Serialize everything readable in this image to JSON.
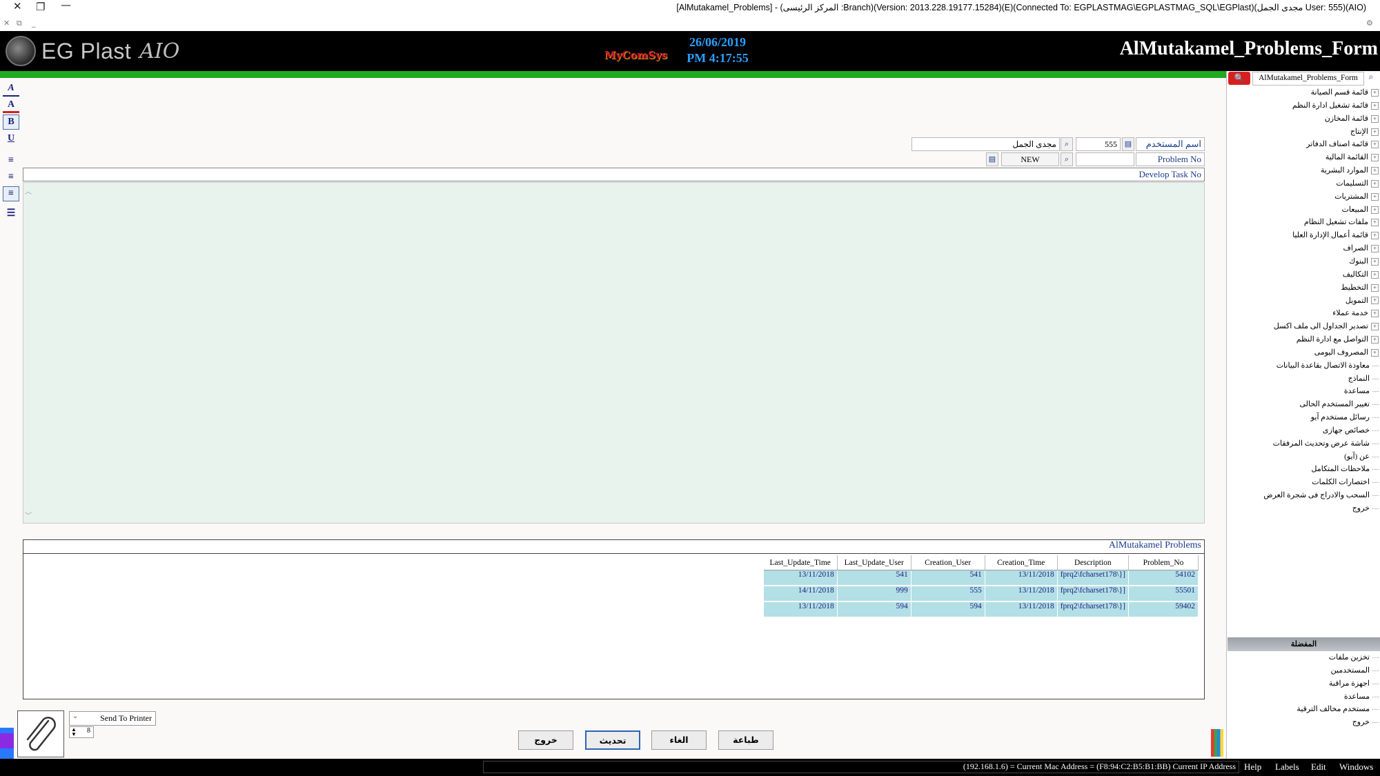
{
  "window": {
    "title": "[AlMutakamel_Problems] - (المركز الرئيسى :Branch)(Version: 2013.228.19177.15284)(E)(Connected To: EGPLASTMAG\\EGPLASTMAG_SQL\\EGPlast)(مجدى الجمل User: 555)(AIO)"
  },
  "header": {
    "brand": "EG Plast",
    "brand_suffix": "AIO",
    "vendor_logo": "MyComSys",
    "date": "26/06/2019",
    "time": "PM 4:17:55",
    "form_title": "AlMutakamel_Problems_Form"
  },
  "toolbar_left": [
    {
      "icon": "font-style-icon",
      "glyph": "A"
    },
    {
      "icon": "font-color-icon",
      "glyph": "A"
    },
    {
      "icon": "bold-icon",
      "glyph": "B"
    },
    {
      "icon": "underline-icon",
      "glyph": "U"
    },
    {
      "icon": "align-left-icon",
      "glyph": "≡"
    },
    {
      "icon": "align-center-icon",
      "glyph": "≡"
    },
    {
      "icon": "align-right-icon",
      "glyph": "≡"
    },
    {
      "icon": "bullet-list-icon",
      "glyph": "☰"
    }
  ],
  "form": {
    "user_label": "اسم المستخدم",
    "user_code": "555",
    "user_name": "مجدى الجمل",
    "problem_label": "Problem No",
    "problem_value": "",
    "problem_status": "NEW",
    "develop_task_label": "Develop Task No"
  },
  "grid": {
    "caption": "AlMutakamel Problems",
    "columns": [
      "Last_Update_Time",
      "Last_Update_User",
      "Creation_User",
      "Creation_Time",
      "Description",
      "Problem_No"
    ],
    "rows": [
      [
        "13/11/2018",
        "541",
        "541",
        "13/11/2018",
        "fprq2\\fcharset178\\}]",
        "54102"
      ],
      [
        "14/11/2018",
        "999",
        "555",
        "13/11/2018",
        "fprq2\\fcharset178\\}]",
        "55501"
      ],
      [
        "13/11/2018",
        "594",
        "594",
        "13/11/2018",
        "fprq2\\fcharset178\\}]",
        "59402"
      ]
    ]
  },
  "bottom": {
    "print_option": "Send To Printer",
    "copies": "8",
    "buttons": {
      "exit": "خروج",
      "update": "تحديث",
      "cancel": "الغاء",
      "print": "طباعة"
    }
  },
  "sidebar": {
    "search_value": "AlMutakamel_Problems_Form",
    "tree": [
      {
        "label": "قائمة قسم الصيانة",
        "expandable": true
      },
      {
        "label": "قائمة تشغيل ادارة النظم",
        "expandable": true
      },
      {
        "label": "قائمة المخازن",
        "expandable": true
      },
      {
        "label": "الإنتاج",
        "expandable": true
      },
      {
        "label": "قائمة اصناف الدفاتر",
        "expandable": true
      },
      {
        "label": "القائمة المالية",
        "expandable": true
      },
      {
        "label": "الموارد البشرية",
        "expandable": true
      },
      {
        "label": "التسليمات",
        "expandable": true
      },
      {
        "label": "المشتريات",
        "expandable": true
      },
      {
        "label": "المبيعات",
        "expandable": true
      },
      {
        "label": "ملفات تشغيل النظام",
        "expandable": true
      },
      {
        "label": "قائمة أعمال الإدارة العليا",
        "expandable": true
      },
      {
        "label": "الصراف",
        "expandable": true
      },
      {
        "label": "البنوك",
        "expandable": true
      },
      {
        "label": "التكاليف",
        "expandable": true
      },
      {
        "label": "التخطيط",
        "expandable": true
      },
      {
        "label": "التمويل",
        "expandable": true
      },
      {
        "label": "خدمة عملاء",
        "expandable": true
      },
      {
        "label": "تصدير الجداول الى ملف اكسل",
        "expandable": true
      },
      {
        "label": "التواصل مع ادارة النظم",
        "expandable": true
      },
      {
        "label": "المصروف اليومى",
        "expandable": true
      },
      {
        "label": "معاودة الاتصال بقاعدة البيانات",
        "expandable": false
      },
      {
        "label": "النماذج",
        "expandable": false
      },
      {
        "label": "مساعدة",
        "expandable": false
      },
      {
        "label": "تغيير المستخدم الحالى",
        "expandable": false
      },
      {
        "label": "رسائل مستخدم آيو",
        "expandable": false
      },
      {
        "label": "خصائص جهازى",
        "expandable": false
      },
      {
        "label": "شاشة عرض وتحديث المرفقات",
        "expandable": false
      },
      {
        "label": "عن (آيو)",
        "expandable": false
      },
      {
        "label": "ملاحظات المتكامل",
        "expandable": false
      },
      {
        "label": "اختصارات الكلمات",
        "expandable": false
      },
      {
        "label": "السحب والادراج فى شجرة العرض",
        "expandable": false
      },
      {
        "label": "خروج",
        "expandable": false
      }
    ],
    "favorites_header": "المفضلة",
    "favorites": [
      "تخزين ملفات",
      "المستخدمين",
      "اجهزة مراقبة",
      "مساعدة",
      "مستخدم مخالف الترقية",
      "خروج"
    ]
  },
  "statusbar": {
    "text": "(192.168.1.6) = Current Mac Address = (F8:94:C2:B5:B1:BB) Current IP Address",
    "menus": [
      "Help",
      "Labels",
      "Edit",
      "Windows"
    ]
  },
  "colors": {
    "header_bg": "#000000",
    "accent_green": "#1faa1f",
    "date_blue": "#2aa0ff",
    "grid_row": "#b3dfe6",
    "editor_bg": "#e8f3ee"
  }
}
